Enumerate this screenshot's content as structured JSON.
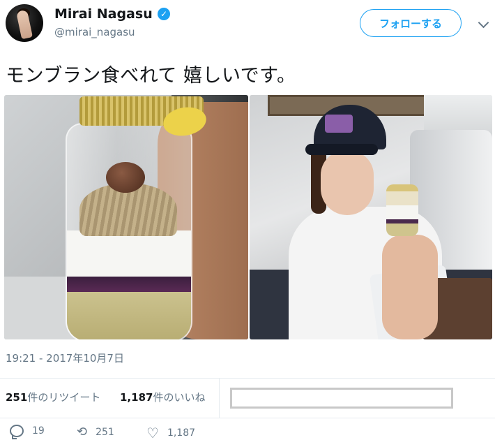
{
  "user": {
    "display_name": "Mirai Nagasu",
    "handle": "@mirai_nagasu",
    "verified": true
  },
  "header": {
    "follow_label": "フォローする"
  },
  "tweet": {
    "text": "モンブラン食べれて 嬉しいです。",
    "timestamp": "19:21 - 2017年10月7日"
  },
  "stats": {
    "retweets_count": "251",
    "retweets_label": "件のリツイート",
    "likes_count": "1,187",
    "likes_label": "件のいいね"
  },
  "actions": {
    "reply_count": "19",
    "retweet_count": "251",
    "like_count": "1,187"
  },
  "colors": {
    "accent": "#1da1f2",
    "secondary_text": "#657786",
    "primary_text": "#14171a"
  }
}
